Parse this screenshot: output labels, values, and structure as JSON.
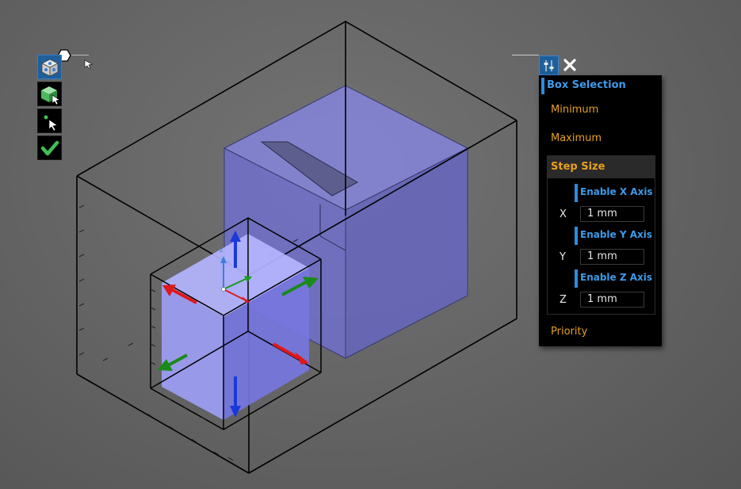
{
  "toolbar": {
    "buttons": [
      {
        "name": "view-cube",
        "icon": "view-cube-icon",
        "active": true
      },
      {
        "name": "select-body",
        "icon": "select-body-icon",
        "active": false
      },
      {
        "name": "select-point",
        "icon": "select-point-icon",
        "active": false
      },
      {
        "name": "accept",
        "icon": "checkmark-icon",
        "active": false
      }
    ]
  },
  "panel": {
    "header_icons": [
      "sliders-icon",
      "close-icon"
    ],
    "mode_label": "Box Selection",
    "minimum_label": "Minimum",
    "maximum_label": "Maximum",
    "step_size_label": "Step Size",
    "axes": [
      {
        "enable_label": "Enable X Axis",
        "axis": "X",
        "value": "1 mm"
      },
      {
        "enable_label": "Enable Y Axis",
        "axis": "Y",
        "value": "1 mm"
      },
      {
        "enable_label": "Enable Z Axis",
        "axis": "Z",
        "value": "1 mm"
      }
    ],
    "priority_label": "Priority"
  },
  "colors": {
    "accent_blue": "#3d9be9",
    "accent_orange": "#e6a020",
    "selection_volume": "#7b7bd8",
    "x_axis": "#e01818",
    "y_axis": "#1a8a1a",
    "z_axis": "#1a3ad8"
  }
}
